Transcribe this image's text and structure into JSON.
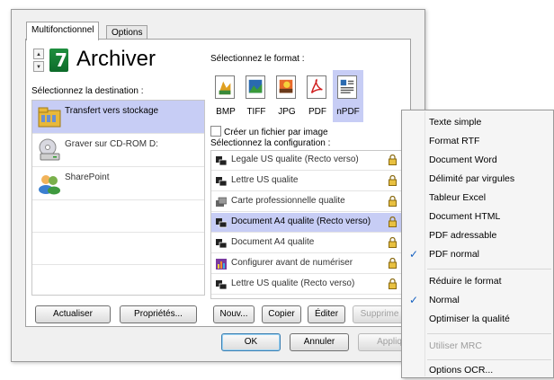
{
  "tabs": [
    {
      "label": "Multifonctionnel",
      "active": true
    },
    {
      "label": "Options",
      "active": false
    }
  ],
  "app": {
    "title": "Archiver",
    "icon": "green-7-icon"
  },
  "destination": {
    "label": "Sélectionnez la destination :",
    "items": [
      {
        "label": "Transfert vers stockage",
        "icon": "folder-icon",
        "selected": true
      },
      {
        "label": "Graver sur CD-ROM  D:",
        "icon": "cd-drive-icon",
        "selected": false
      },
      {
        "label": "SharePoint",
        "icon": "sharepoint-icon",
        "selected": false
      }
    ],
    "buttons": {
      "refresh": "Actualiser",
      "properties": "Propriétés..."
    }
  },
  "format": {
    "label": "Sélectionnez le format :",
    "items": [
      {
        "label": "BMP",
        "icon": "bmp-icon",
        "selected": false
      },
      {
        "label": "TIFF",
        "icon": "tiff-icon",
        "selected": false
      },
      {
        "label": "JPG",
        "icon": "jpg-icon",
        "selected": false
      },
      {
        "label": "PDF",
        "icon": "pdf-icon",
        "selected": false
      },
      {
        "label": "nPDF",
        "icon": "npdf-icon",
        "selected": true
      }
    ],
    "checkbox_label": "Créer un fichier par image",
    "checkbox_checked": false
  },
  "configuration": {
    "label": "Sélectionnez la configuration :",
    "items": [
      {
        "label": "Legale US qualite (Recto verso)",
        "icon": "scanner-icon",
        "selected": false
      },
      {
        "label": "Lettre US qualite",
        "icon": "scanner-icon",
        "selected": false
      },
      {
        "label": "Carte professionnelle qualite",
        "icon": "business-card-icon",
        "selected": false
      },
      {
        "label": "Document A4 qualite (Recto verso)",
        "icon": "scanner-icon",
        "selected": true
      },
      {
        "label": "Document A4 qualite",
        "icon": "scanner-icon",
        "selected": false
      },
      {
        "label": "Configurer avant de numériser",
        "icon": "configure-icon",
        "selected": false
      },
      {
        "label": "Lettre US qualite (Recto verso)",
        "icon": "scanner-icon",
        "selected": false
      }
    ],
    "buttons": {
      "new": "Nouv...",
      "copy": "Copier",
      "edit": "Éditer",
      "delete": "Supprime"
    }
  },
  "dialog_buttons": {
    "ok": "OK",
    "cancel": "Annuler",
    "apply": "Appliq"
  },
  "context_menu": {
    "items": [
      {
        "label": "Texte simple",
        "checked": false,
        "disabled": false
      },
      {
        "label": "Format RTF",
        "checked": false,
        "disabled": false
      },
      {
        "label": "Document Word",
        "checked": false,
        "disabled": false
      },
      {
        "label": "Délimité par virgules",
        "checked": false,
        "disabled": false
      },
      {
        "label": "Tableur Excel",
        "checked": false,
        "disabled": false
      },
      {
        "label": "Document HTML",
        "checked": false,
        "disabled": false
      },
      {
        "label": "PDF adressable",
        "checked": false,
        "disabled": false
      },
      {
        "label": "PDF normal",
        "checked": true,
        "disabled": false
      },
      {
        "label": "Réduire le format",
        "checked": false,
        "disabled": false
      },
      {
        "label": "Normal",
        "checked": true,
        "disabled": false
      },
      {
        "label": "Optimiser la qualité",
        "checked": false,
        "disabled": false
      },
      {
        "label": "Utiliser MRC",
        "checked": false,
        "disabled": true
      },
      {
        "label": "Options OCR...",
        "checked": false,
        "disabled": false
      }
    ],
    "check_glyph": "✓"
  },
  "colors": {
    "selection": "#c7cdf5",
    "menu_check": "#1560c0"
  }
}
